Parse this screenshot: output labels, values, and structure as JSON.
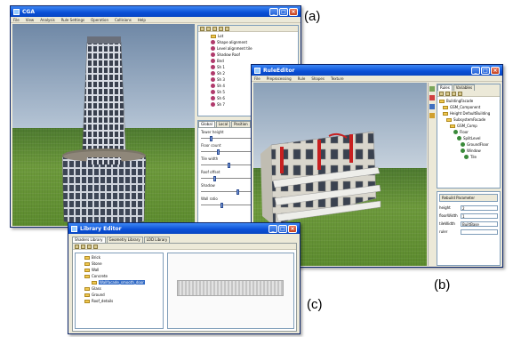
{
  "labels": {
    "a": "(a)",
    "b": "(b)",
    "c": "(c)"
  },
  "window_a": {
    "title": "CGA",
    "menu": [
      "File",
      "View",
      "Analysis",
      "Rule Settings",
      "Operation",
      "Collisions",
      "Help"
    ],
    "tree_items": [
      "Lot",
      "Shape alignment",
      "Level alignment tile",
      "Shadow Roof",
      "Bnd",
      "Sh 1",
      "Sh 2",
      "Sh 3",
      "Sh 4",
      "Sh 5",
      "Sh 6",
      "Sh 7"
    ],
    "tabs": [
      "Global",
      "Local",
      "Position"
    ],
    "params": [
      "Tower height",
      "Floor count",
      "Tile width",
      "Roof offset",
      "Shadow",
      "Wall ratio"
    ]
  },
  "window_b": {
    "title": "RuleEditor",
    "menu": [
      "File",
      "Preprocessing",
      "Rule",
      "Shapes",
      "Texture"
    ],
    "tabs": [
      "Rules",
      "Variables"
    ],
    "tree_items": [
      "BuildingFacade",
      "GSM_Component",
      "Height DefaultBuilding",
      "SubsystemFacade",
      "GSM_Comp",
      "Floor",
      "SplitLevel",
      "GroundFloor",
      "Window",
      "Tile"
    ],
    "fields": [
      {
        "label": "height",
        "value": "2"
      },
      {
        "label": "floorWidth",
        "value": "1"
      },
      {
        "label": "tileWidth",
        "value": "BuiltBase"
      },
      {
        "label": "ruler",
        "value": ""
      }
    ],
    "button": "Rebuild Parameter"
  },
  "window_c": {
    "title": "Library Editor",
    "tabs": [
      "Shaders Library",
      "Geometry Library",
      "LOD Library"
    ],
    "tree_items": [
      "Brick",
      "Stone",
      "Wall",
      "Concrete",
      "Wallfacade_smooth_door",
      "Glass",
      "Ground",
      "Roof_details"
    ]
  }
}
